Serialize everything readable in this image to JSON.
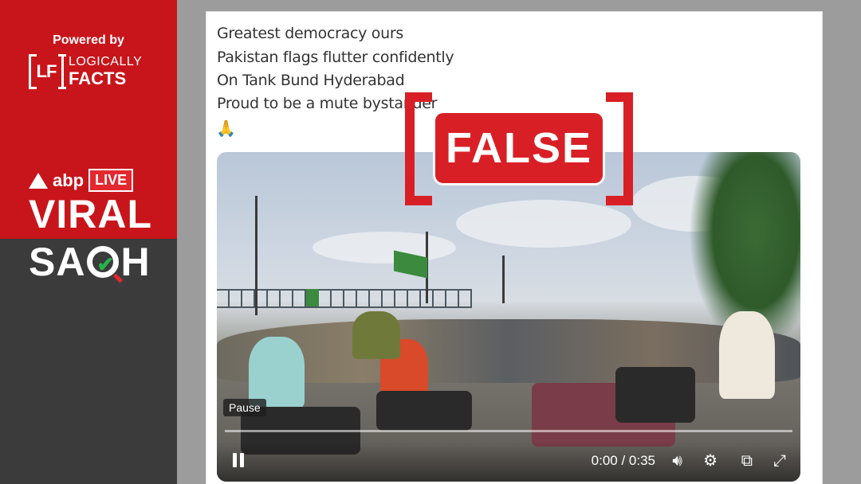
{
  "brand": {
    "powered_by": "Powered by",
    "lf_mark": "LF",
    "lf_name_top": "LOGICALLY",
    "lf_name_bottom": "FACTS",
    "abp": "abp",
    "live": "LIVE",
    "viral": "VIRAL",
    "sach_prefix": "SA",
    "sach_suffix": "H",
    "colors": {
      "red": "#c8151b",
      "dark": "#3b3b3b"
    }
  },
  "tweet": {
    "lines": [
      "Greatest democracy ours",
      "Pakistan flags flutter confidently",
      "On Tank Bund Hyderabad",
      "Proud to be a mute bystander"
    ],
    "emoji": "🙏"
  },
  "video": {
    "tooltip": "Pause",
    "time": "0:00 / 0:35",
    "icons": [
      "pause-icon",
      "volume-icon",
      "settings-icon",
      "popout-icon",
      "fullscreen-icon"
    ]
  },
  "verdict": {
    "label": "FALSE",
    "color": "#d91f26"
  }
}
